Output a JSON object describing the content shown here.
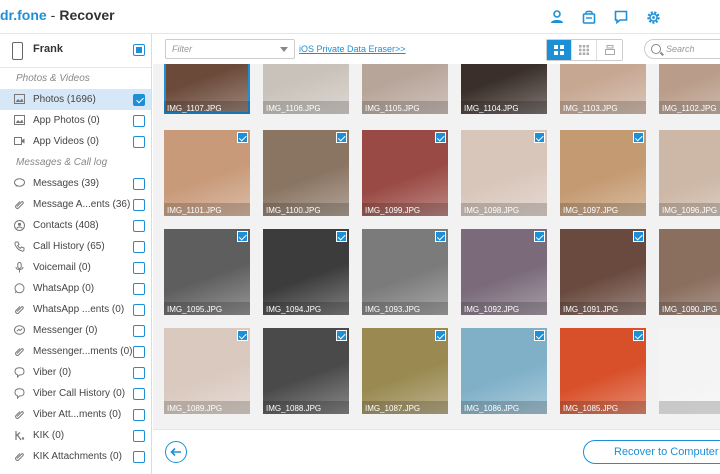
{
  "app": {
    "logo": "dr.fone",
    "separator": "-",
    "title": "Recover"
  },
  "header_icons": [
    "user-icon",
    "cart-icon",
    "chat-icon",
    "gear-icon"
  ],
  "device": {
    "name": "Frank"
  },
  "sidebar": {
    "section_photos": "Photos & Videos",
    "section_messages": "Messages & Call log",
    "photos_items": [
      {
        "label": "Photos (1696)",
        "icon": "image-icon",
        "checked": true
      },
      {
        "label": "App Photos (0)",
        "icon": "image-icon",
        "checked": false
      },
      {
        "label": "App Videos (0)",
        "icon": "video-icon",
        "checked": false
      }
    ],
    "message_items": [
      {
        "label": "Messages (39)",
        "icon": "message-icon",
        "checked": false
      },
      {
        "label": "Message A...ents (36)",
        "icon": "paperclip-icon",
        "checked": false
      },
      {
        "label": "Contacts (408)",
        "icon": "contact-icon",
        "checked": false
      },
      {
        "label": "Call History (65)",
        "icon": "phone-icon",
        "checked": false
      },
      {
        "label": "Voicemail (0)",
        "icon": "microphone-icon",
        "checked": false
      },
      {
        "label": "WhatsApp (0)",
        "icon": "whatsapp-icon",
        "checked": false
      },
      {
        "label": "WhatsApp ...ents (0)",
        "icon": "paperclip-icon",
        "checked": false
      },
      {
        "label": "Messenger (0)",
        "icon": "messenger-icon",
        "checked": false
      },
      {
        "label": "Messenger...ments (0)",
        "icon": "paperclip-icon",
        "checked": false
      },
      {
        "label": "Viber (0)",
        "icon": "viber-icon",
        "checked": false
      },
      {
        "label": "Viber Call History (0)",
        "icon": "viber-icon",
        "checked": false
      },
      {
        "label": "Viber Att...ments (0)",
        "icon": "paperclip-icon",
        "checked": false
      },
      {
        "label": "KIK (0)",
        "icon": "kik-icon",
        "checked": false
      },
      {
        "label": "KIK Attachments (0)",
        "icon": "paperclip-icon",
        "checked": false
      }
    ]
  },
  "toolbar": {
    "filter_placeholder": "Filter",
    "eraser_link": "iOS Private Data Eraser>>",
    "search_placeholder": "Search"
  },
  "photos": [
    {
      "name": "IMG_1107.JPG",
      "checked": false,
      "color": "#6b4a3a"
    },
    {
      "name": "IMG_1106.JPG",
      "checked": false,
      "color": "#c9c2ba"
    },
    {
      "name": "IMG_1105.JPG",
      "checked": false,
      "color": "#b7a59a"
    },
    {
      "name": "IMG_1104.JPG",
      "checked": false,
      "color": "#3a2f2a"
    },
    {
      "name": "IMG_1103.JPG",
      "checked": false,
      "color": "#c6a792"
    },
    {
      "name": "IMG_1102.JPG",
      "checked": false,
      "color": "#b99c89"
    },
    {
      "name": "IMG_1101.JPG",
      "checked": true,
      "color": "#c89a7a"
    },
    {
      "name": "IMG_1100.JPG",
      "checked": true,
      "color": "#8a7563"
    },
    {
      "name": "IMG_1099.JPG",
      "checked": true,
      "color": "#9a4a44"
    },
    {
      "name": "IMG_1098.JPG",
      "checked": true,
      "color": "#d8c6bb"
    },
    {
      "name": "IMG_1097.JPG",
      "checked": true,
      "color": "#c49a72"
    },
    {
      "name": "IMG_1096.JPG",
      "checked": true,
      "color": "#cdb7a6"
    },
    {
      "name": "IMG_1095.JPG",
      "checked": true,
      "color": "#5e5e5e"
    },
    {
      "name": "IMG_1094.JPG",
      "checked": true,
      "color": "#3c3c3c"
    },
    {
      "name": "IMG_1093.JPG",
      "checked": true,
      "color": "#7b7b7b"
    },
    {
      "name": "IMG_1092.JPG",
      "checked": true,
      "color": "#7a6a7a"
    },
    {
      "name": "IMG_1091.JPG",
      "checked": true,
      "color": "#6a4a3e"
    },
    {
      "name": "IMG_1090.JPG",
      "checked": true,
      "color": "#8a6e5e"
    },
    {
      "name": "IMG_1089.JPG",
      "checked": true,
      "color": "#d9c9bf"
    },
    {
      "name": "IMG_1088.JPG",
      "checked": true,
      "color": "#4a4a4a"
    },
    {
      "name": "IMG_1087.JPG",
      "checked": true,
      "color": "#9a8a52"
    },
    {
      "name": "IMG_1086.JPG",
      "checked": true,
      "color": "#7fb0c8"
    },
    {
      "name": "IMG_1085.JPG",
      "checked": true,
      "color": "#d8502a"
    },
    {
      "name": "",
      "checked": true,
      "color": "#f4f4f4"
    }
  ],
  "footer": {
    "recover_button": "Recover to Computer"
  },
  "colors": {
    "accent": "#1d8fd6",
    "selected_row": "#d6e8f7"
  }
}
